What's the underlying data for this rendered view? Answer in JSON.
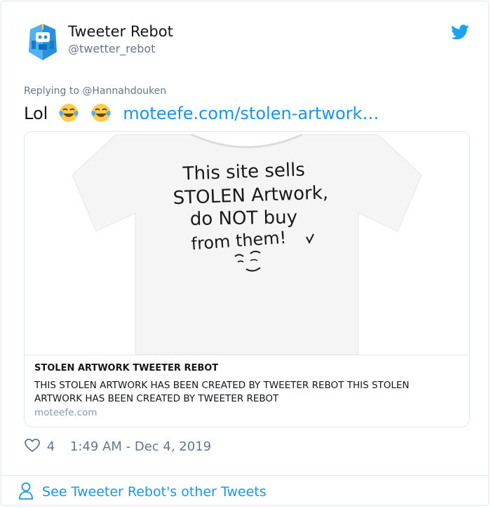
{
  "author": {
    "name": "Tweeter Rebot",
    "handle": "@twetter_rebot",
    "avatar_icon": "robot-bird-avatar",
    "brand_icon": "twitter-bird-icon"
  },
  "tweet": {
    "replying_prefix": "Replying to",
    "replying_to": "@Hannahdouken",
    "text": "Lol",
    "emojis": [
      "face-with-tears-of-joy",
      "face-with-tears-of-joy"
    ],
    "link_text": "moteefe.com/stolen-artwork…"
  },
  "card": {
    "image_text_lines": [
      "This site sells",
      "STOLEN Artwork,",
      "do NOT buy",
      "from them!"
    ],
    "title": "STOLEN ARTWORK TWEETER REBOT",
    "description": "THIS STOLEN ARTWORK HAS BEEN CREATED BY TWEETER REBOT THIS STOLEN ARTWORK HAS BEEN CREATED BY TWEETER REBOT",
    "domain": "moteefe.com"
  },
  "meta": {
    "likes": "4",
    "timestamp": "1:49 AM - Dec 4, 2019"
  },
  "footer": {
    "see_more": "See Tweeter Rebot's other Tweets"
  },
  "colors": {
    "link": "#1b95e0",
    "muted": "#657786",
    "border": "#e1e8ed"
  }
}
